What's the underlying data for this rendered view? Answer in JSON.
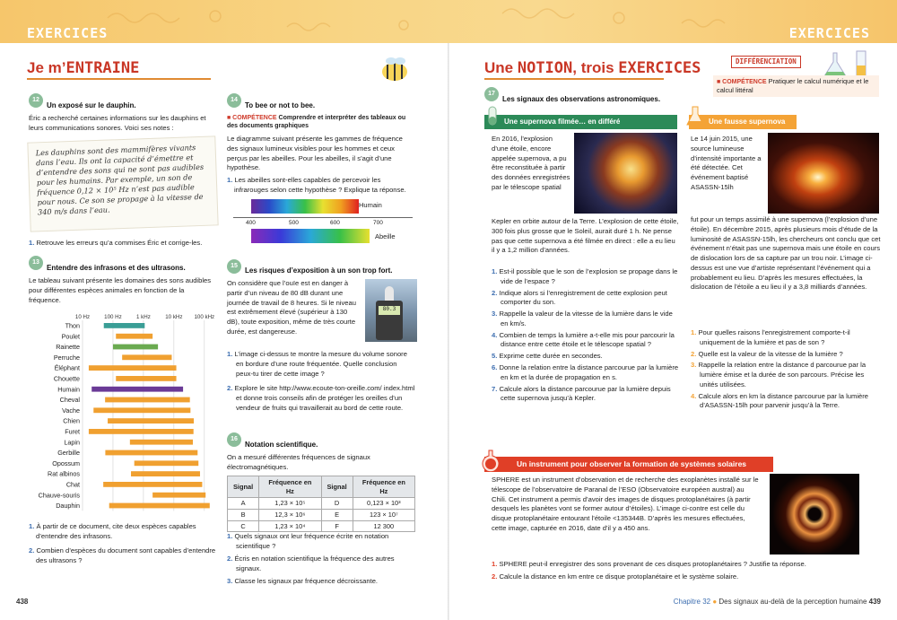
{
  "header": {
    "left_title": "EXERCICES",
    "right_title": "EXERCICES"
  },
  "left": {
    "section_title_a": "Je m’",
    "section_title_b": "ENTRAINE",
    "ex12": {
      "num": "12",
      "title": "Un exposé sur le dauphin.",
      "intro": "Éric a recherché certaines informations sur les dauphins et leurs communications sonores. Voici ses notes :",
      "note": "Les dauphins sont des mammifères vivants dans l’eau. Ils ont la capacité d’émettre et d’entendre des sons qui ne sont pas audibles pour les humains. Par exemple, un son de fréquence 0,12 × 10⁵ Hz n’est pas audible pour nous. Ce son se propage à la vitesse de 340 m/s dans l’eau.",
      "q1n": "1.",
      "q1": "Retrouve les erreurs qu’a commises Éric et corrige-les."
    },
    "ex13": {
      "num": "13",
      "title": "Entendre des infrasons et des ultrasons.",
      "intro": "Le tableau suivant présente les domaines des sons audibles pour différentes espèces animales en fonction de la fréquence.",
      "q1n": "1.",
      "q1": "À partir de ce document, cite deux espèces capables d’entendre des infrasons.",
      "q2n": "2.",
      "q2": "Combien d’espèces du document sont capables d’entendre des ultrasons ?"
    },
    "ex14": {
      "num": "14",
      "title": "To bee or not to bee.",
      "comp_label": "■ COMPÉTENCE",
      "comp": "Comprendre et interpréter des tableaux ou des documents graphiques",
      "intro": "Le diagramme suivant présente les gammes de fréquence des signaux lumineux visibles pour les hommes et ceux perçus par les abeilles. Pour les abeilles, il s’agit d’une hypothèse.",
      "q1n": "1.",
      "q1": "Les abeilles sont-elles capables de percevoir les infrarouges selon cette hypothèse ? Explique ta réponse.",
      "spec_human": "Humain",
      "spec_bee": "Abeille",
      "spec_ticks": [
        "400",
        "500",
        "600",
        "700"
      ]
    },
    "ex15": {
      "num": "15",
      "title": "Les risques d’exposition à un son trop fort.",
      "intro": "On considère que l’ouïe est en danger à partir d’un niveau de 80 dB durant une journée de travail de 8 heures. Si le niveau est extrêmement élevé (supérieur à 130 dB), toute exposition, même de très courte durée, est dangereuse.",
      "q1n": "1.",
      "q1": "L’image ci-dessus te montre la mesure du volume sonore en bordure d’une route fréquentée. Quelle conclusion peux-tu tirer de cette image ?",
      "q2n": "2.",
      "q2": "Explore le site http://www.ecoute-ton-oreille.com/ index.html et donne trois conseils afin de protéger les oreilles d’un vendeur de fruits qui travaillerait au bord de cette route.",
      "meter_value": "80.3"
    },
    "ex16": {
      "num": "16",
      "title": "Notation scientifique.",
      "intro": "On a mesuré différentes fréquences de signaux électromagnétiques.",
      "headers": [
        "Signal",
        "Fréquence en Hz",
        "Signal",
        "Fréquence en Hz"
      ],
      "rows": [
        [
          "A",
          "1,23 × 10⁵",
          "D",
          "0,123 × 10³"
        ],
        [
          "B",
          "12,3 × 10⁶",
          "E",
          "123 × 10⁷"
        ],
        [
          "C",
          "1,23 × 10⁴",
          "F",
          "12 300"
        ]
      ],
      "q1n": "1.",
      "q1": "Quels signaux ont leur fréquence écrite en notation scientifique ?",
      "q2n": "2.",
      "q2": "Écris en notation scientifique la fréquence des autres signaux.",
      "q3n": "3.",
      "q3": "Classe les signaux par fréquence décroissante."
    },
    "page_number": "438"
  },
  "chart_data": {
    "type": "bar",
    "title": "",
    "x_scale": "log",
    "x_ticks": [
      "10 Hz",
      "100 Hz",
      "1 kHz",
      "10 kHz",
      "100 kHz"
    ],
    "categories": [
      "Thon",
      "Poulet",
      "Rainette",
      "Perruche",
      "Éléphant",
      "Chouette",
      "Humain",
      "Cheval",
      "Vache",
      "Chien",
      "Furet",
      "Lapin",
      "Gerbille",
      "Opossum",
      "Rat albinos",
      "Chat",
      "Chauve-souris",
      "Dauphin"
    ],
    "ranges_hz": [
      [
        50,
        1100
      ],
      [
        125,
        2000
      ],
      [
        100,
        3000
      ],
      [
        200,
        8500
      ],
      [
        16,
        12000
      ],
      [
        125,
        12000
      ],
      [
        20,
        20000
      ],
      [
        55,
        33500
      ],
      [
        23,
        35000
      ],
      [
        67,
        45000
      ],
      [
        16,
        44000
      ],
      [
        360,
        42000
      ],
      [
        56,
        60000
      ],
      [
        500,
        64000
      ],
      [
        390,
        72000
      ],
      [
        48,
        85000
      ],
      [
        2000,
        110000
      ],
      [
        75,
        150000
      ]
    ],
    "colors": [
      "#3a9e96",
      "#f0a030",
      "#6aaa50",
      "#f0a030",
      "#f0a030",
      "#f0a030",
      "#6a3a96",
      "#f0a030",
      "#f0a030",
      "#f0a030",
      "#f0a030",
      "#f0a030",
      "#f0a030",
      "#f0a030",
      "#f0a030",
      "#f0a030",
      "#f0a030",
      "#f0a030"
    ]
  },
  "right": {
    "title_a": "Une ",
    "title_b": "NOTION",
    "title_c": ", trois ",
    "title_d": "EXERCICES",
    "diff_label": "DIFFÉRENCIATION",
    "comp_label": "■ COMPÉTENCE",
    "comp": "Pratiquer le calcul numérique et le calcul littéral",
    "ex17": {
      "num": "17",
      "title": "Les signaux des observations astronomiques."
    },
    "green": {
      "title": "Une supernova filmée… en différé",
      "text1": "En 2016, l’explosion d’une étoile, encore appelée supernova, a pu être reconstituée à partir des données enregistrées par le télescope spatial",
      "text2": "Kepler en orbite autour de la Terre. L’explosion de cette étoile, 300 fois plus grosse que le Soleil, aurait duré 1 h. Ne pense pas que cette supernova a été filmée en direct : elle a eu lieu il y a 1,2 million d’années.",
      "questions": [
        {
          "n": "1.",
          "t": "Est-il possible que le son de l’explosion se propage dans le vide de l’espace ?"
        },
        {
          "n": "2.",
          "t": "Indique alors si l’enregistrement de cette explosion peut comporter du son."
        },
        {
          "n": "3.",
          "t": "Rappelle la valeur de la vitesse de la lumière dans le vide en km/s."
        },
        {
          "n": "4.",
          "t": "Combien de temps la lumière a-t-elle mis pour parcourir la distance entre cette étoile et le télescope spatial ?"
        },
        {
          "n": "5.",
          "t": "Exprime cette durée en secondes."
        },
        {
          "n": "6.",
          "t": "Donne la relation entre la distance parcourue par la lumière en km et la durée de propagation en s."
        },
        {
          "n": "7.",
          "t": "Calcule alors la distance parcourue par la lumière depuis cette supernova jusqu’à Kepler."
        }
      ]
    },
    "orange": {
      "title": "Une fausse supernova",
      "text1": "Le 14 juin 2015, une source lumineuse d’intensité importante a été détectée. Cet événement baptisé ASASSN-15lh",
      "text2": "fut pour un temps assimilé à une supernova (l’explosion d’une étoile). En décembre 2015, après plusieurs mois d’étude de la luminosité de ASASSN-15lh, les chercheurs ont conclu que cet événement n’était pas une supernova mais une étoile en cours de dislocation lors de sa capture par un trou noir. L’image ci-dessus est une vue d’artiste représentant l’événement qui a probablement eu lieu. D’après les mesures effectuées, la dislocation de l’étoile a eu lieu il y a 3,8 milliards d’années.",
      "questions": [
        {
          "n": "1.",
          "t": "Pour quelles raisons l’enregistrement comporte-t-il uniquement de la lumière et pas de son ?"
        },
        {
          "n": "2.",
          "t": "Quelle est la valeur de la vitesse de la lumière ?"
        },
        {
          "n": "3.",
          "t": "Rappelle la relation entre la distance d parcourue par la lumière émise et la durée de son parcours. Précise les unités utilisées."
        },
        {
          "n": "4.",
          "t": "Calcule alors en km la distance parcourue par la lumière d’ASASSN-15lh pour parvenir jusqu’à la Terre."
        }
      ]
    },
    "red": {
      "title": "Un instrument pour observer la formation de systèmes solaires",
      "text": "SPHERE est un instrument d’observation et de recherche des exoplanètes installé sur le télescope de l’observatoire de Paranal de l’ESO (Observatoire européen austral) au Chili. Cet instrument a permis d’avoir des images de disques protoplanétaires (à partir desquels les planètes vont se former autour d’étoiles). L’image ci-contre est celle du disque protoplanétaire entourant l’étoile <135344B. D’après les mesures effectuées, cette image, capturée en 2016, date d’il y a 450 ans.",
      "questions": [
        {
          "n": "1.",
          "t": "SPHERE peut-il enregistrer des sons provenant de ces disques protoplanétaires ? Justifie ta réponse."
        },
        {
          "n": "2.",
          "t": "Calcule la distance en km entre ce disque protoplanétaire et le système solaire."
        }
      ]
    },
    "footer_chapter": "Chapitre 32",
    "footer_title": "Des signaux au-delà de la perception humaine",
    "page_number": "439"
  }
}
